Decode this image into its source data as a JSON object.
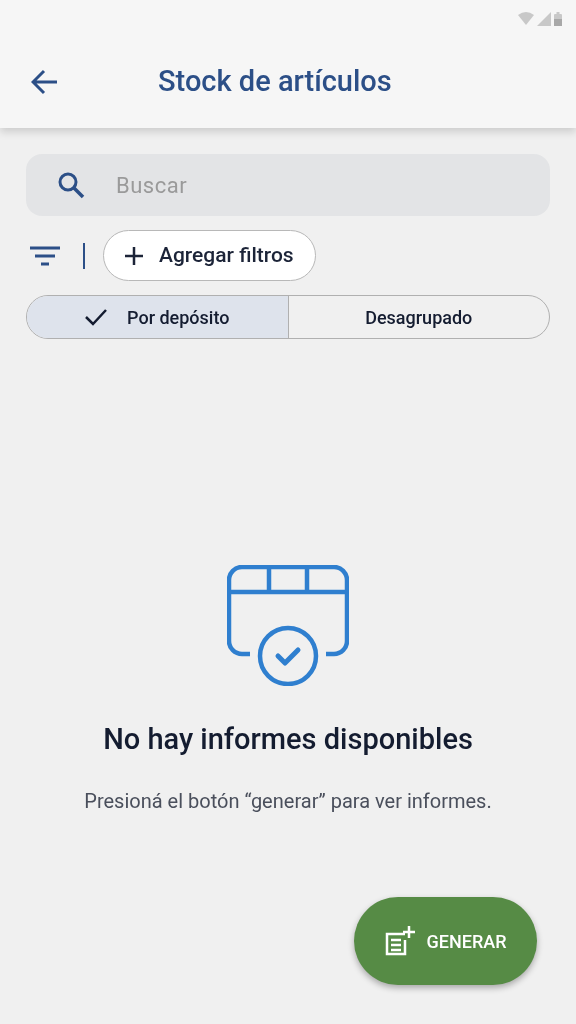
{
  "app_bar": {
    "title": "Stock de artículos"
  },
  "search": {
    "placeholder": "Buscar"
  },
  "filters": {
    "add_label": "Agregar filtros"
  },
  "grouping": [
    {
      "label": "Por depósito",
      "selected": true
    },
    {
      "label": "Desagrupado",
      "selected": false
    }
  ],
  "empty_state": {
    "title": "No hay informes disponibles",
    "message": "Presioná el botón “generar” para ver informes."
  },
  "fab": {
    "label": "GENERAR"
  }
}
